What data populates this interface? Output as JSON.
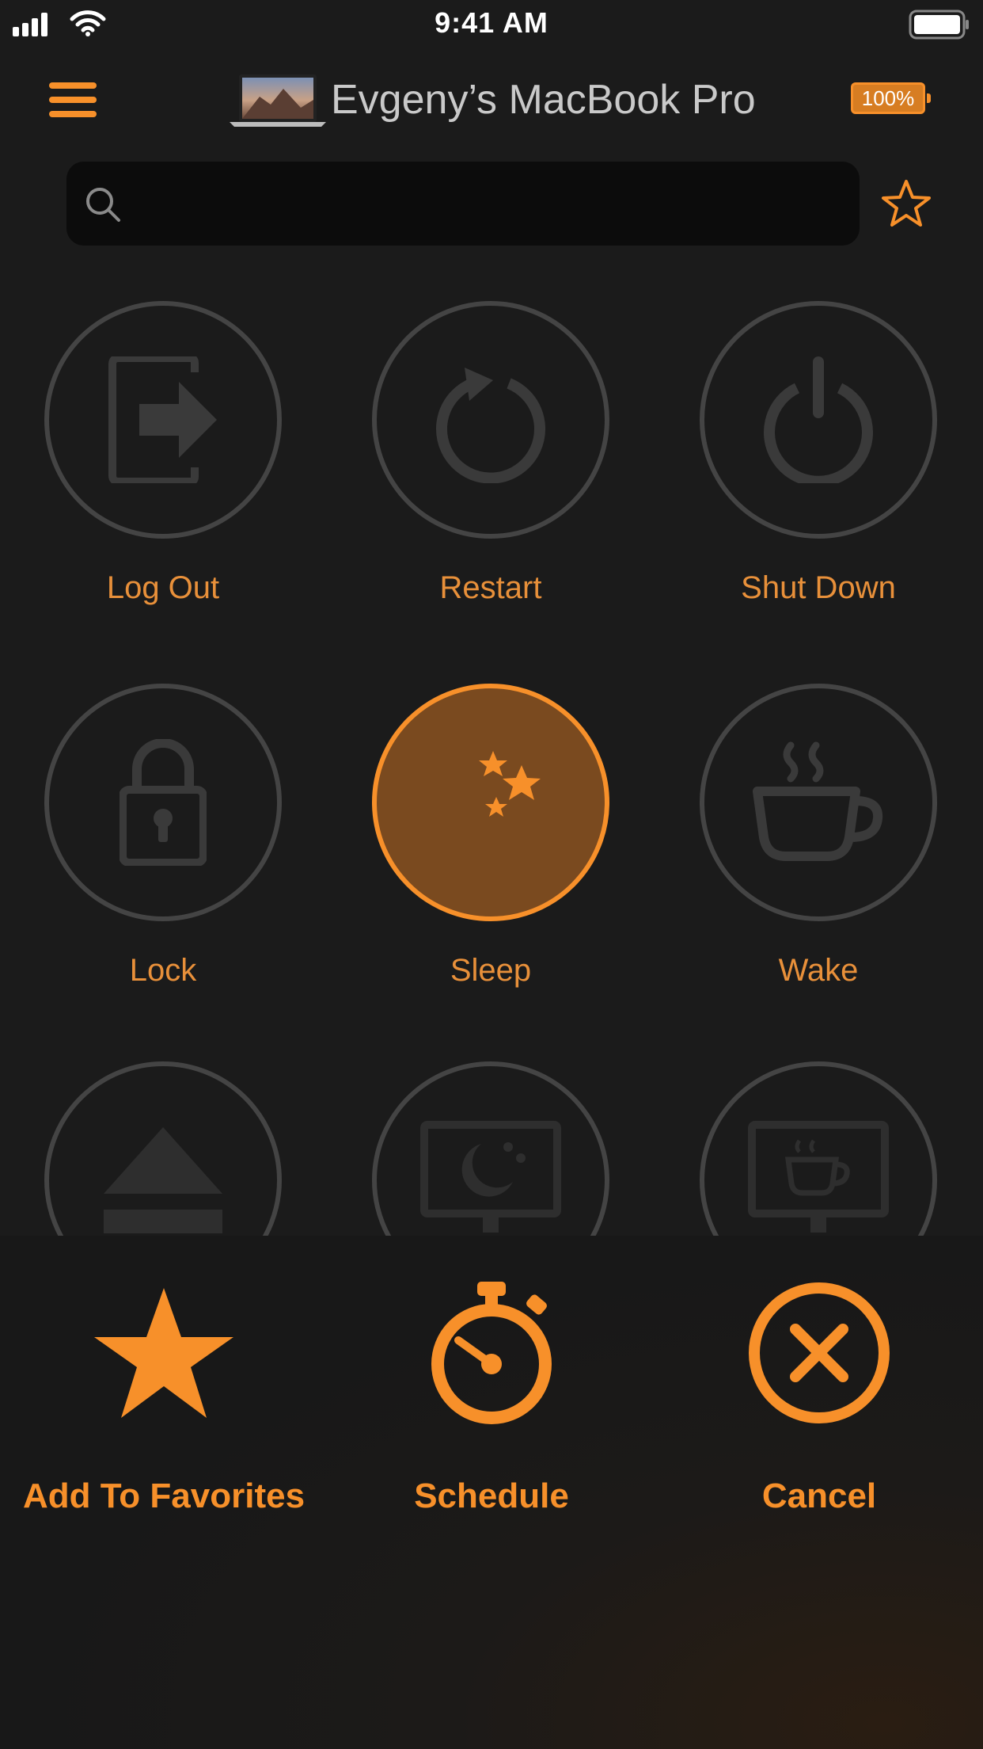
{
  "status_bar": {
    "time": "9:41 AM"
  },
  "header": {
    "device_name": "Evgeny’s MacBook Pro",
    "battery": "100%"
  },
  "search": {
    "value": "",
    "placeholder": ""
  },
  "colors": {
    "accent": "#f7902a",
    "background": "#1b1b1b",
    "circle_border": "#444444",
    "active_fill": "#7a4a1f"
  },
  "actions": [
    {
      "label": "Log Out",
      "icon": "log-out-icon"
    },
    {
      "label": "Restart",
      "icon": "restart-icon"
    },
    {
      "label": "Shut Down",
      "icon": "power-icon"
    },
    {
      "label": "Lock",
      "icon": "lock-icon"
    },
    {
      "label": "Sleep",
      "icon": "moon-stars-icon",
      "selected": true
    },
    {
      "label": "Wake",
      "icon": "coffee-cup-icon"
    },
    {
      "icon": "eject-icon"
    },
    {
      "icon": "display-sleep-icon"
    },
    {
      "icon": "display-wake-icon"
    }
  ],
  "sheet": {
    "favorites_label": "Add To Favorites",
    "schedule_label": "Schedule",
    "cancel_label": "Cancel"
  }
}
